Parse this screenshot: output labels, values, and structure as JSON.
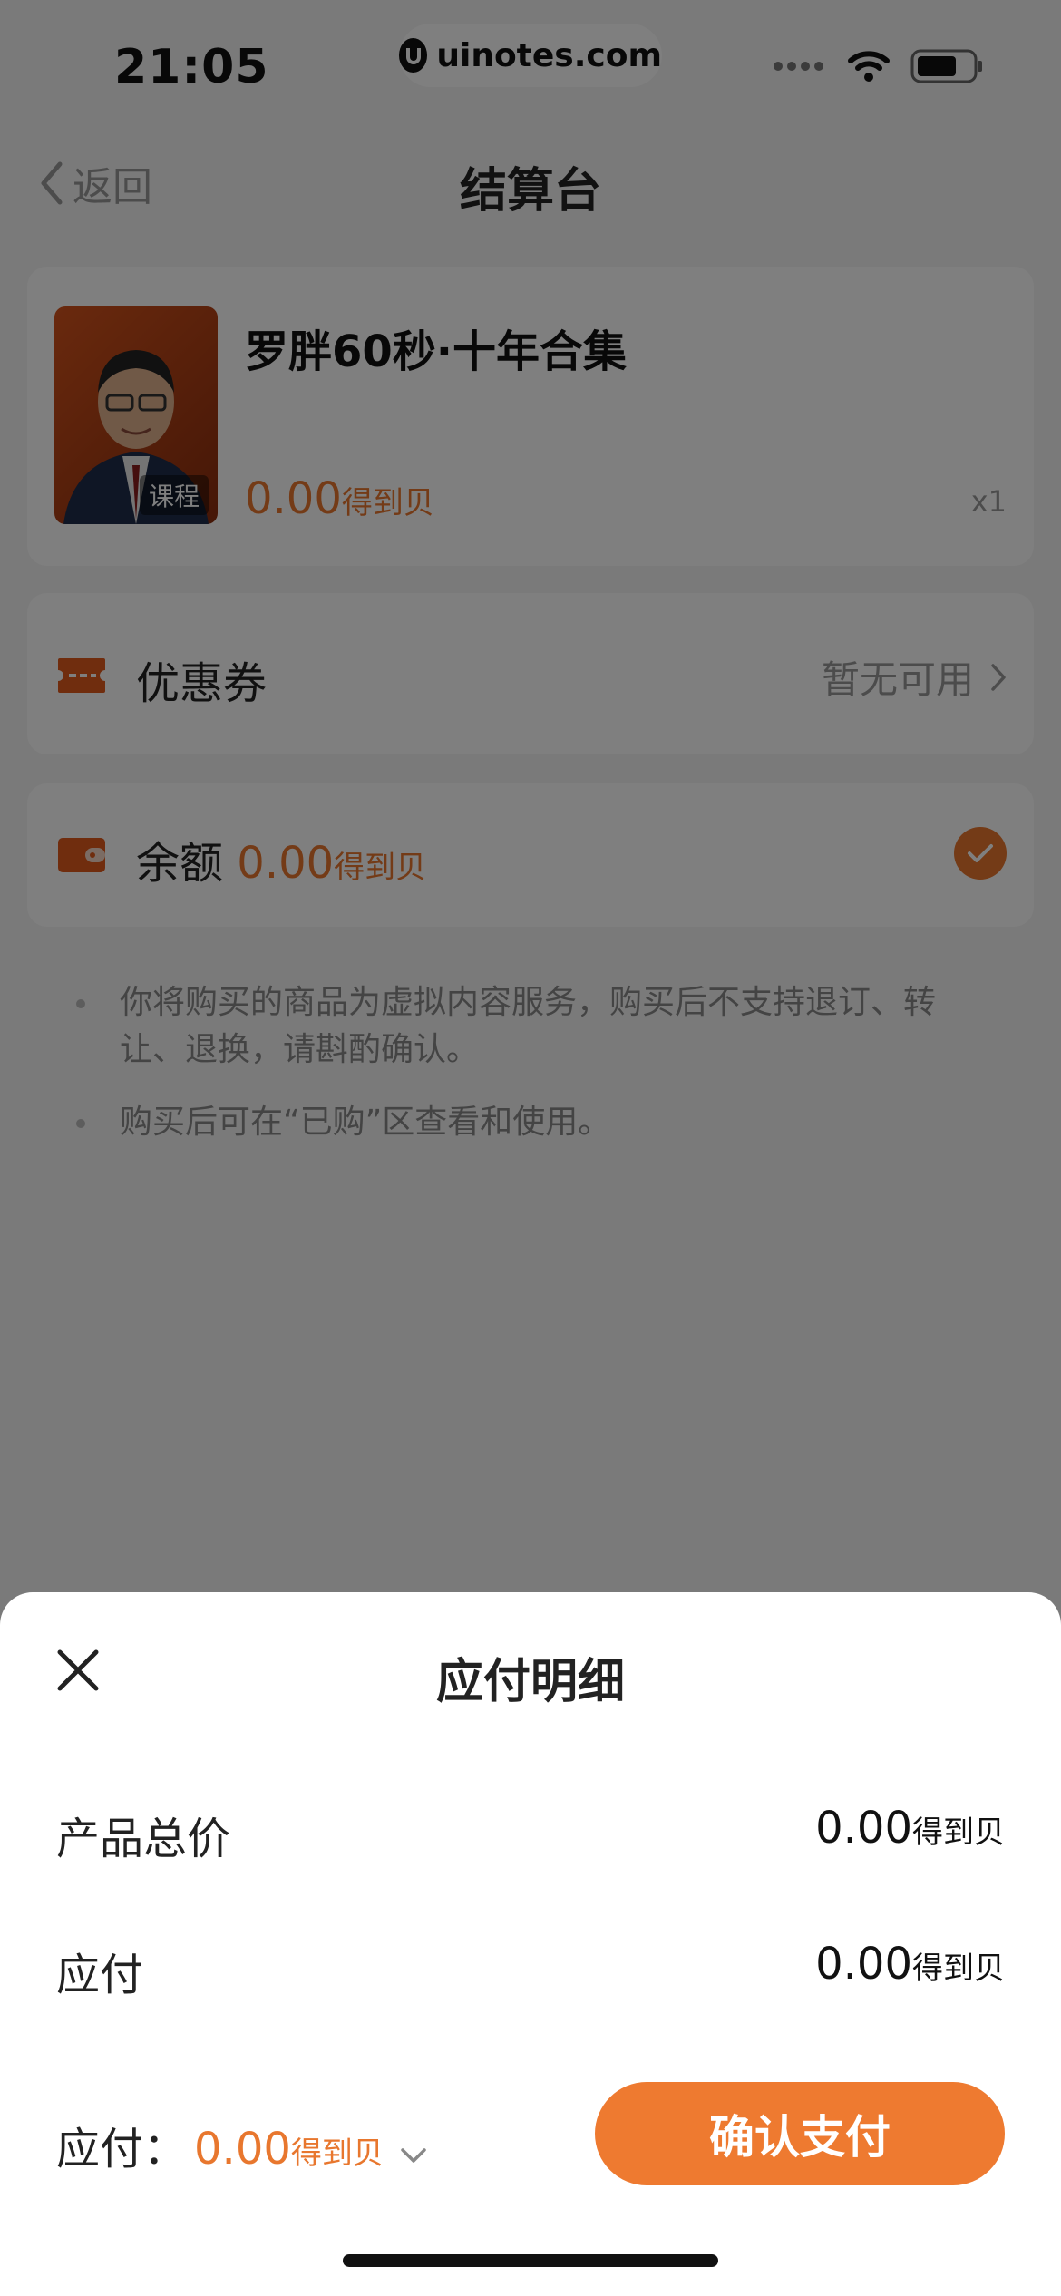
{
  "status_bar": {
    "time": "21:05",
    "watermark": "uinotes.com"
  },
  "nav": {
    "back_label": "返回",
    "title": "结算台"
  },
  "product": {
    "title": "罗胖60秒·十年合集",
    "badge": "课程",
    "price": "0.00",
    "price_unit": "得到贝",
    "quantity": "x1"
  },
  "coupon": {
    "label": "优惠券",
    "status": "暂无可用"
  },
  "balance": {
    "label": "余额",
    "amount": "0.00",
    "unit": "得到贝",
    "checked": true
  },
  "notes": [
    "你将购买的商品为虚拟内容服务，购买后不支持退订、转让、退换，请斟酌确认。",
    "购买后可在“已购”区查看和使用。"
  ],
  "sheet": {
    "title": "应付明细",
    "rows": [
      {
        "label": "产品总价",
        "value": "0.00",
        "unit": "得到贝"
      },
      {
        "label": "应付",
        "value": "0.00",
        "unit": "得到贝"
      }
    ],
    "pay_label": "应付：",
    "pay_amount": "0.00",
    "pay_unit": "得到贝",
    "confirm_label": "确认支付"
  },
  "colors": {
    "accent": "#ee7a30",
    "overlay": "rgba(0,0,0,0.5)"
  }
}
